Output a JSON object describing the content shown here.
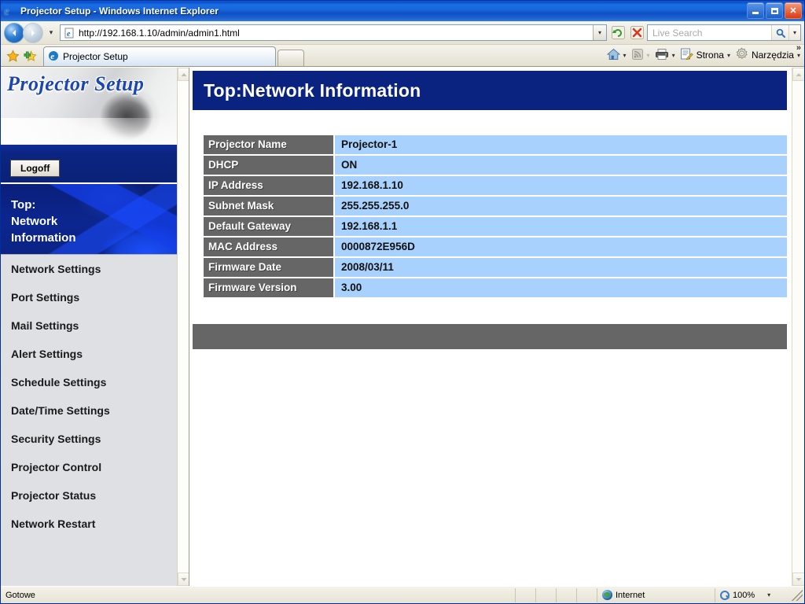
{
  "window": {
    "title": "Projector Setup - Windows Internet Explorer",
    "minimize_label": "_",
    "restore_label": "❐",
    "close_label": "✕"
  },
  "browser": {
    "back_label": "◀",
    "forward_label": "▶",
    "history_caret": "▾",
    "address": {
      "url": "http://192.168.1.10/admin/admin1.html",
      "dropdown_caret": "▾",
      "page_icon": "page-icon"
    },
    "refresh_icon": "refresh-icon",
    "stop_icon": "stop-icon",
    "search": {
      "placeholder": "Live Search",
      "search_icon": "search-icon",
      "dropdown_caret": "▾"
    },
    "favorites_icon": "favorites-star-icon",
    "add_favorite_icon": "add-favorite-icon",
    "tab": {
      "label": "Projector Setup"
    },
    "new_tab_label": "",
    "toolbar": {
      "home_label": "",
      "feeds_label": "",
      "print_label": "",
      "page_label": "Strona",
      "tools_label": "Narzędzia",
      "overflow_label": "»",
      "caret": "▾"
    }
  },
  "statusbar": {
    "status_text": "Gotowe",
    "zone_label": "Internet",
    "zoom_label": "100%",
    "zoom_caret": "▾"
  },
  "sidebar": {
    "logo_text": "Projector Setup",
    "logoff_label": "Logoff",
    "active_item": {
      "line1": "Top:",
      "line2": "Network",
      "line3": "Information"
    },
    "items": [
      {
        "label": "Network Settings"
      },
      {
        "label": "Port Settings"
      },
      {
        "label": "Mail Settings"
      },
      {
        "label": "Alert Settings"
      },
      {
        "label": "Schedule Settings"
      },
      {
        "label": "Date/Time Settings"
      },
      {
        "label": "Security Settings"
      },
      {
        "label": "Projector Control"
      },
      {
        "label": "Projector Status"
      },
      {
        "label": "Network Restart"
      }
    ],
    "scroll_up": "▲",
    "scroll_down": "▼"
  },
  "content": {
    "page_title": "Top:Network Information",
    "table": {
      "rows": [
        {
          "label": "Projector Name",
          "value": "Projector-1"
        },
        {
          "label": "DHCP",
          "value": "ON"
        },
        {
          "label": "IP Address",
          "value": "192.168.1.10"
        },
        {
          "label": "Subnet Mask",
          "value": "255.255.255.0"
        },
        {
          "label": "Default Gateway",
          "value": "192.168.1.1"
        },
        {
          "label": "MAC Address",
          "value": "0000872E956D"
        },
        {
          "label": "Firmware Date",
          "value": "2008/03/11"
        },
        {
          "label": "Firmware Version",
          "value": "3.00"
        }
      ]
    },
    "footer_bar_text": ""
  },
  "colors": {
    "title_navy": "#0b2380",
    "label_gray": "#666666",
    "value_blue": "#a8d2fd",
    "logo_blue": "#1c46b4",
    "titlebar_blue": "#1666da"
  }
}
